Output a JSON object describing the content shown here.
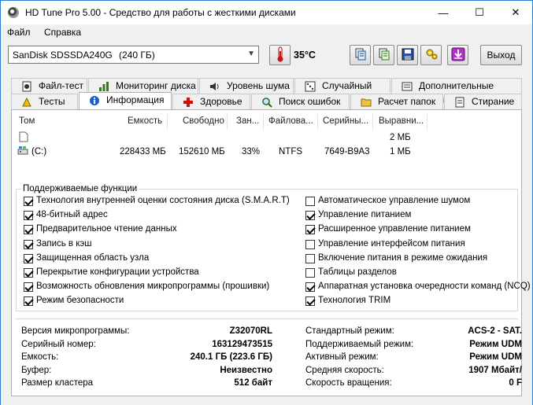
{
  "window": {
    "title": "HD Tune Pro 5.00 - Средство для работы с жесткими дисками",
    "minimize": "—",
    "maximize": "☐",
    "close": "✕"
  },
  "menu": [
    "Файл",
    "Справка"
  ],
  "toolbar": {
    "drive": "SanDisk SDSSDA240G",
    "capacity": "(240 ГБ)",
    "temperature": "35°C",
    "exit_label": "Выход"
  },
  "tabs_row1": [
    {
      "label": "Файл-тест",
      "icon": "file-test-icon"
    },
    {
      "label": "Мониторинг диска",
      "icon": "monitor-chart-icon"
    },
    {
      "label": "Уровень шума",
      "icon": "speaker-icon"
    },
    {
      "label": "Случайный тест",
      "icon": "dice-icon"
    },
    {
      "label": "Дополнительные тесты",
      "icon": "extra-tests-icon"
    }
  ],
  "tabs_row2": [
    {
      "label": "Тесты",
      "icon": "tests-icon"
    },
    {
      "label": "Информация",
      "icon": "info-icon"
    },
    {
      "label": "Здоровье",
      "icon": "health-cross-icon"
    },
    {
      "label": "Поиск ошибок",
      "icon": "magnifier-icon"
    },
    {
      "label": "Расчет папок",
      "icon": "folder-icon"
    },
    {
      "label": "Стирание",
      "icon": "erase-icon"
    }
  ],
  "volumes": {
    "headers": [
      "Том",
      "Емкость",
      "Свободно",
      "Зан...",
      "Файлова...",
      "Серийны...",
      "Выравни..."
    ],
    "rows": [
      {
        "name": "",
        "capacity": "",
        "free": "",
        "used": "",
        "fs": "",
        "serial": "",
        "align": "2 МБ"
      },
      {
        "name": "(C:)",
        "capacity": "228433 МБ",
        "free": "152610 МБ",
        "used": "33%",
        "fs": "NTFS",
        "serial": "7649-B9A3",
        "align": "1 МБ"
      }
    ]
  },
  "features": {
    "title": "Поддерживаемые функции",
    "left": [
      {
        "label": "Технология внутренней оценки состояния диска (S.M.A.R.T)",
        "checked": true
      },
      {
        "label": "48-битный адрес",
        "checked": true
      },
      {
        "label": "Предварительное чтение данных",
        "checked": true
      },
      {
        "label": "Запись в кэш",
        "checked": true
      },
      {
        "label": "Защищенная область узла",
        "checked": true
      },
      {
        "label": "Перекрытие конфигурации устройства",
        "checked": true
      },
      {
        "label": "Возможность обновления микропрограммы (прошивки)",
        "checked": true
      },
      {
        "label": "Режим безопасности",
        "checked": true
      }
    ],
    "right": [
      {
        "label": "Автоматическое управление шумом",
        "checked": false
      },
      {
        "label": "Управление питанием",
        "checked": true
      },
      {
        "label": "Расширенное управление питанием",
        "checked": true
      },
      {
        "label": "Управление интерфейсом питания",
        "checked": false
      },
      {
        "label": "Включение питания в режиме ожидания",
        "checked": false
      },
      {
        "label": "Таблицы разделов",
        "checked": false
      },
      {
        "label": "Аппаратная установка очередности команд (NCQ)",
        "checked": true
      },
      {
        "label": "Технология TRIM",
        "checked": true
      }
    ]
  },
  "info": {
    "left": [
      {
        "label": "Версия микропрограммы:",
        "value": "Z32070RL"
      },
      {
        "label": "Серийный номер:",
        "value": "163129473515"
      },
      {
        "label": "Емкость:",
        "value": "240.1 ГБ (223.6 ГБ)"
      },
      {
        "label": "Буфер:",
        "value": "Неизвестно"
      },
      {
        "label": "Размер кластера",
        "value": "512 байт"
      }
    ],
    "right": [
      {
        "label": "Стандартный режим:",
        "value": "ACS-2 - SAT."
      },
      {
        "label": "Поддерживаемый режим:",
        "value": "Режим UDM"
      },
      {
        "label": "Активный режим:",
        "value": "Режим UDM"
      },
      {
        "label": "Средняя скорость:",
        "value": "1907 Мбайт/"
      },
      {
        "label": "Скорость вращения:",
        "value": "0 F"
      }
    ]
  }
}
